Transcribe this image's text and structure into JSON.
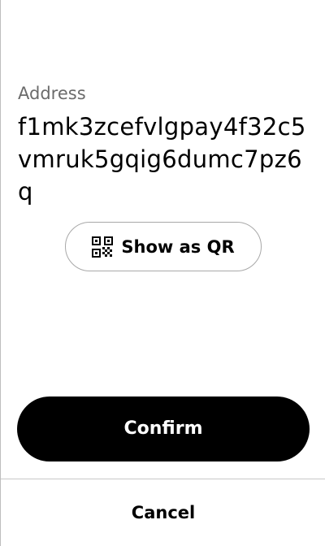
{
  "address": {
    "label": "Address",
    "value": "f1mk3zcefvlgpay4f32c5vmruk5gqig6dumc7pz6q"
  },
  "qr_button": {
    "label": "Show as QR",
    "icon": "qr-code-icon"
  },
  "actions": {
    "confirm_label": "Confirm",
    "cancel_label": "Cancel"
  },
  "colors": {
    "confirm_background": "#000000",
    "confirm_text": "#ffffff",
    "label_text": "#6b6b6b",
    "border": "#a8a8a8"
  }
}
